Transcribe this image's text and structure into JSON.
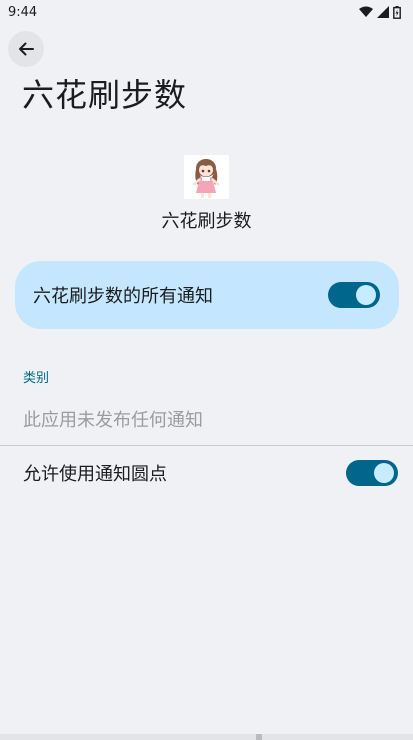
{
  "status_bar": {
    "time": "9:44",
    "icons": [
      "wifi-icon",
      "signal-icon",
      "battery-icon"
    ]
  },
  "header": {
    "back_icon": "arrow-left-icon",
    "title": "六花刷步数"
  },
  "app": {
    "name": "六花刷步数",
    "icon": "anime-girl-app-icon"
  },
  "all_notifications": {
    "label": "六花刷步数的所有通知",
    "enabled": true
  },
  "categories": {
    "section_label": "类别",
    "empty_text": "此应用未发布任何通知"
  },
  "notification_dot": {
    "label": "允许使用通知圆点",
    "enabled": true
  },
  "colors": {
    "background": "#eff1f4",
    "accent": "#00668b",
    "card": "#c4e7ff",
    "switch_thumb": "#c8ecff"
  }
}
